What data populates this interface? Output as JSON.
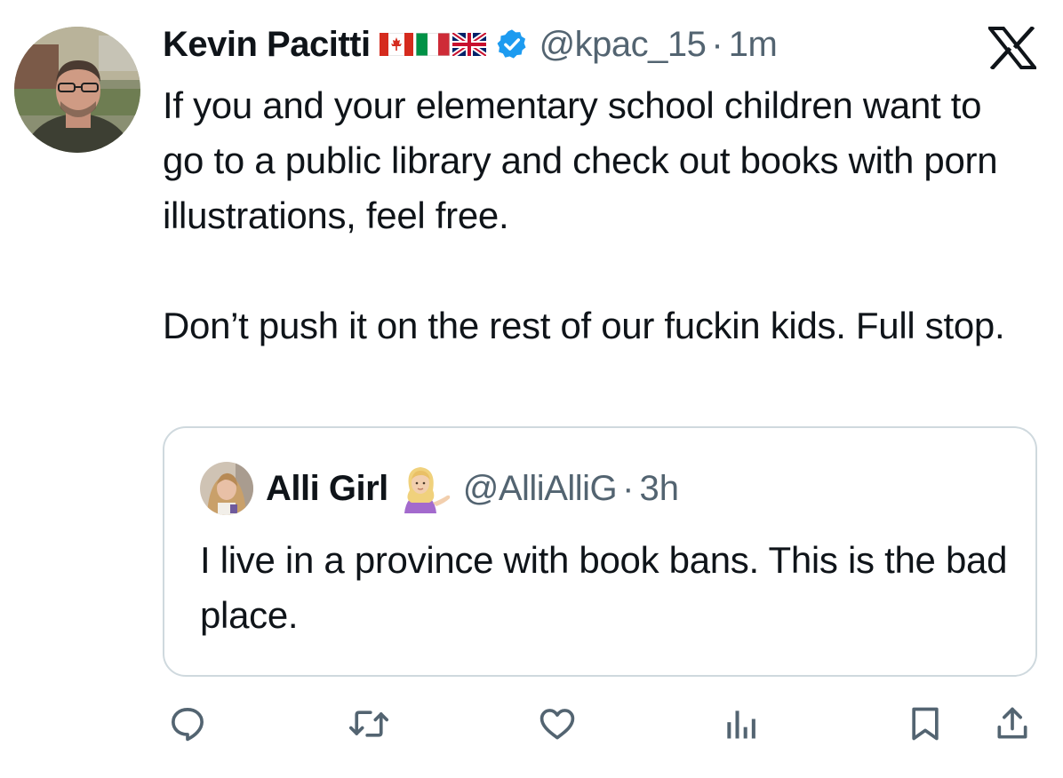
{
  "tweet": {
    "author_name": "Kevin Pacitti",
    "flags": [
      "canada-flag-icon",
      "italy-flag-icon",
      "uk-flag-icon"
    ],
    "verified_icon": "verified-badge-icon",
    "handle": "@kpac_15",
    "separator": "·",
    "time": "1m",
    "text_paragraphs": [
      "If you and your elementary school children want to go to a public library and check out books with porn illustrations, feel free.",
      "Don’t push it on the rest of our fuckin kids. Full stop."
    ]
  },
  "quoted_tweet": {
    "author_name": "Alli Girl",
    "emoji_icon": "person-tipping-hand-icon",
    "handle": "@AlliAlliG",
    "separator": "·",
    "time": "3h",
    "text": "I live in a province with book bans. This is the bad place."
  },
  "actions": {
    "icons": [
      "reply-icon",
      "retweet-icon",
      "like-icon",
      "views-icon",
      "bookmark-icon",
      "share-icon"
    ]
  },
  "brand": {
    "logo_icon": "x-logo-icon",
    "verified_color": "#1d9bf0",
    "secondary_text_color": "#536471",
    "border_color": "#cfd9de"
  }
}
